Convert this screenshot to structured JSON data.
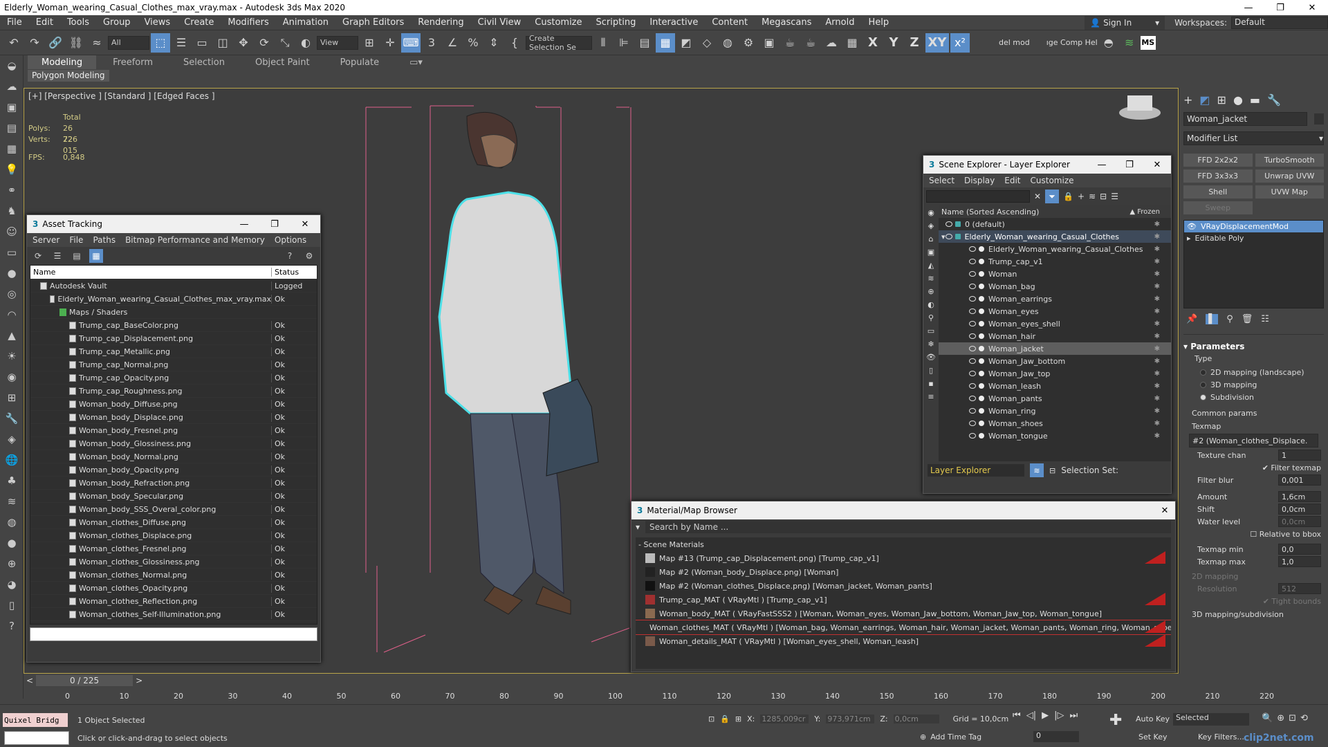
{
  "window": {
    "title": "Elderly_Woman_wearing_Casual_Clothes_max_vray.max - Autodesk 3ds Max 2020",
    "controls": [
      "—",
      "❐",
      "✕"
    ]
  },
  "menu": {
    "items": [
      "File",
      "Edit",
      "Tools",
      "Group",
      "Views",
      "Create",
      "Modifiers",
      "Animation",
      "Graph Editors",
      "Rendering",
      "Civil View",
      "Customize",
      "Scripting",
      "Interactive",
      "Content",
      "Megascans",
      "Arnold",
      "Help"
    ],
    "signin": "Sign In",
    "workspaces_label": "Workspaces:",
    "workspaces_value": "Default"
  },
  "toolbar": {
    "filter": "All",
    "view": "View",
    "selection_set": "Create Selection Se",
    "axes": [
      "X",
      "Y",
      "Z",
      "XY"
    ],
    "del_mod": "del mod",
    "comp_help": "ıge Comp Hel",
    "ms": "MS"
  },
  "ribbon": {
    "tabs": [
      "Modeling",
      "Freeform",
      "Selection",
      "Object Paint",
      "Populate"
    ],
    "subtab": "Polygon Modeling"
  },
  "viewport": {
    "label": "[+] [Perspective ] [Standard ] [Edged Faces ]",
    "stats": {
      "total": "Total",
      "polys_label": "Polys:",
      "polys": "26 726",
      "verts_label": "Verts:",
      "verts": "22 015",
      "fps_label": "FPS:",
      "fps": "0,848"
    }
  },
  "asset_tracking": {
    "title": "Asset Tracking",
    "menu": [
      "Server",
      "File",
      "Paths",
      "Bitmap Performance and Memory",
      "Options"
    ],
    "col_name": "Name",
    "col_status": "Status",
    "rows": [
      {
        "name": "Autodesk Vault",
        "status": "Logged",
        "indent": 1
      },
      {
        "name": "Elderly_Woman_wearing_Casual_Clothes_max_vray.max",
        "status": "Ok",
        "indent": 2
      },
      {
        "name": "Maps / Shaders",
        "status": "",
        "indent": 3
      },
      {
        "name": "Trump_cap_BaseColor.png",
        "status": "Ok",
        "indent": 4
      },
      {
        "name": "Trump_cap_Displacement.png",
        "status": "Ok",
        "indent": 4
      },
      {
        "name": "Trump_cap_Metallic.png",
        "status": "Ok",
        "indent": 4
      },
      {
        "name": "Trump_cap_Normal.png",
        "status": "Ok",
        "indent": 4
      },
      {
        "name": "Trump_cap_Opacity.png",
        "status": "Ok",
        "indent": 4
      },
      {
        "name": "Trump_cap_Roughness.png",
        "status": "Ok",
        "indent": 4
      },
      {
        "name": "Woman_body_Diffuse.png",
        "status": "Ok",
        "indent": 4
      },
      {
        "name": "Woman_body_Displace.png",
        "status": "Ok",
        "indent": 4
      },
      {
        "name": "Woman_body_Fresnel.png",
        "status": "Ok",
        "indent": 4
      },
      {
        "name": "Woman_body_Glossiness.png",
        "status": "Ok",
        "indent": 4
      },
      {
        "name": "Woman_body_Normal.png",
        "status": "Ok",
        "indent": 4
      },
      {
        "name": "Woman_body_Opacity.png",
        "status": "Ok",
        "indent": 4
      },
      {
        "name": "Woman_body_Refraction.png",
        "status": "Ok",
        "indent": 4
      },
      {
        "name": "Woman_body_Specular.png",
        "status": "Ok",
        "indent": 4
      },
      {
        "name": "Woman_body_SSS_Overal_color.png",
        "status": "Ok",
        "indent": 4
      },
      {
        "name": "Woman_clothes_Diffuse.png",
        "status": "Ok",
        "indent": 4
      },
      {
        "name": "Woman_clothes_Displace.png",
        "status": "Ok",
        "indent": 4
      },
      {
        "name": "Woman_clothes_Fresnel.png",
        "status": "Ok",
        "indent": 4
      },
      {
        "name": "Woman_clothes_Glossiness.png",
        "status": "Ok",
        "indent": 4
      },
      {
        "name": "Woman_clothes_Normal.png",
        "status": "Ok",
        "indent": 4
      },
      {
        "name": "Woman_clothes_Opacity.png",
        "status": "Ok",
        "indent": 4
      },
      {
        "name": "Woman_clothes_Reflection.png",
        "status": "Ok",
        "indent": 4
      },
      {
        "name": "Woman_clothes_Self-Illumination.png",
        "status": "Ok",
        "indent": 4
      }
    ]
  },
  "scene_explorer": {
    "title": "Scene Explorer - Layer Explorer",
    "menu": [
      "Select",
      "Display",
      "Edit",
      "Customize"
    ],
    "col_name": "Name (Sorted Ascending)",
    "col_frozen": "▲ Frozen",
    "rows": [
      {
        "name": "0 (default)",
        "level": 1,
        "sel": false
      },
      {
        "name": "Elderly_Woman_wearing_Casual_Clothes",
        "level": 1,
        "sel": false
      },
      {
        "name": "Elderly_Woman_wearing_Casual_Clothes",
        "level": 2,
        "sel": false
      },
      {
        "name": "Trump_cap_v1",
        "level": 2,
        "sel": false
      },
      {
        "name": "Woman",
        "level": 2,
        "sel": false
      },
      {
        "name": "Woman_bag",
        "level": 2,
        "sel": false
      },
      {
        "name": "Woman_earrings",
        "level": 2,
        "sel": false
      },
      {
        "name": "Woman_eyes",
        "level": 2,
        "sel": false
      },
      {
        "name": "Woman_eyes_shell",
        "level": 2,
        "sel": false
      },
      {
        "name": "Woman_hair",
        "level": 2,
        "sel": false
      },
      {
        "name": "Woman_jacket",
        "level": 2,
        "sel": true
      },
      {
        "name": "Woman_Jaw_bottom",
        "level": 2,
        "sel": false
      },
      {
        "name": "Woman_Jaw_top",
        "level": 2,
        "sel": false
      },
      {
        "name": "Woman_leash",
        "level": 2,
        "sel": false
      },
      {
        "name": "Woman_pants",
        "level": 2,
        "sel": false
      },
      {
        "name": "Woman_ring",
        "level": 2,
        "sel": false
      },
      {
        "name": "Woman_shoes",
        "level": 2,
        "sel": false
      },
      {
        "name": "Woman_tongue",
        "level": 2,
        "sel": false
      }
    ],
    "footer_left": "Layer Explorer",
    "footer_right": "Selection Set:"
  },
  "material_browser": {
    "title": "Material/Map Browser",
    "search_placeholder": "Search by Name ...",
    "section": "- Scene Materials",
    "rows": [
      {
        "text": "Map #13 (Trump_cap_Displacement.png) [Trump_cap_v1]",
        "swatch": "#bbbbbb",
        "red": true,
        "sel": false
      },
      {
        "text": "Map #2 (Woman_body_Displace.png) [Woman]",
        "swatch": "#222222",
        "red": false,
        "sel": false
      },
      {
        "text": "Map #2 (Woman_clothes_Displace.png) [Woman_jacket, Woman_pants]",
        "swatch": "#111111",
        "red": false,
        "sel": false
      },
      {
        "text": "Trump_cap_MAT ( VRayMtl ) [Trump_cap_v1]",
        "swatch": "#a03030",
        "red": true,
        "sel": false
      },
      {
        "text": "Woman_body_MAT ( VRayFastSSS2 ) [Woman, Woman_eyes, Woman_Jaw_bottom, Woman_Jaw_top, Woman_tongue]",
        "swatch": "#8a6a50",
        "red": false,
        "sel": false
      },
      {
        "text": "Woman_clothes_MAT ( VRayMtl ) [Woman_bag, Woman_earrings, Woman_hair, Woman_jacket, Woman_pants, Woman_ring, Woman_shoes]",
        "swatch": "#555b66",
        "red": true,
        "sel": true
      },
      {
        "text": "Woman_details_MAT ( VRayMtl ) [Woman_eyes_shell, Woman_leash]",
        "swatch": "#7a5a4a",
        "red": true,
        "sel": false
      }
    ]
  },
  "command_panel": {
    "object_name": "Woman_jacket",
    "modifier_list": "Modifier List",
    "buttons": [
      "FFD 2x2x2",
      "TurboSmooth",
      "FFD 3x3x3",
      "Unwrap UVW",
      "Shell",
      "UVW Map",
      "Sweep"
    ],
    "stack": [
      "VRayDisplacementMod",
      "Editable Poly"
    ],
    "parameters": "Parameters",
    "type_label": "Type",
    "types": [
      "2D mapping (landscape)",
      "3D mapping",
      "Subdivision"
    ],
    "common_params": "Common params",
    "texmap_label": "Texmap",
    "texmap_value": "#2 (Woman_clothes_Displace.",
    "texture_chan_label": "Texture chan",
    "texture_chan": "1",
    "filter_texmap": "Filter texmap",
    "filter_blur_label": "Filter blur",
    "filter_blur": "0,001",
    "amount_label": "Amount",
    "amount": "1,6cm",
    "shift_label": "Shift",
    "shift": "0,0cm",
    "water_level_label": "Water level",
    "water_level": "0,0cm",
    "relative_bbox": "Relative to bbox",
    "texmap_min_label": "Texmap min",
    "texmap_min": "0,0",
    "texmap_max_label": "Texmap max",
    "texmap_max": "1,0",
    "mapping2d": "2D mapping",
    "resolution_label": "Resolution",
    "resolution": "512",
    "tight_bounds": "Tight bounds",
    "mapping3d": "3D mapping/subdivision"
  },
  "timeline": {
    "frame": "0 / 225",
    "ticks": [
      "0",
      "10",
      "20",
      "30",
      "40",
      "50",
      "60",
      "70",
      "80",
      "90",
      "100",
      "110",
      "120",
      "130",
      "140",
      "150",
      "160",
      "170",
      "180",
      "190",
      "200",
      "210",
      "220"
    ]
  },
  "status": {
    "script_field": "Quixel Bridg",
    "selected": "1 Object Selected",
    "prompt": "Click or click-and-drag to select objects",
    "x_label": "X:",
    "x": "1285,009cr",
    "y_label": "Y:",
    "y": "973,971cm",
    "z_label": "Z:",
    "z": "0,0cm",
    "grid": "Grid = 10,0cm",
    "add_time_tag": "Add Time Tag",
    "auto_key": "Auto Key",
    "selected_dd": "Selected",
    "set_key": "Set Key",
    "key_filters": "Key Filters...",
    "frame_field": "0",
    "watermark": "clip2net.com"
  }
}
